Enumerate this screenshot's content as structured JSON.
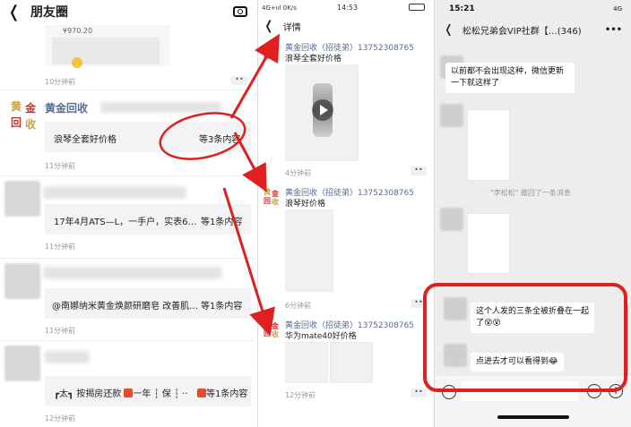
{
  "colors": {
    "link": "#576b95",
    "annotation_red": "#e02020",
    "gold": "#c9a23a"
  },
  "moments": {
    "title": "朋友圈",
    "back_icon": "chevron-left-icon",
    "camera_icon": "camera-icon",
    "top_price": "¥970.20",
    "post0_time": "10分钟前",
    "post1": {
      "author": "黄金回收",
      "avatar_chars": [
        "黄",
        "金",
        "回",
        "收"
      ],
      "share_text": "浪琴全套好价格",
      "more_text": "等3条内容",
      "time": "11分钟前"
    },
    "post2": {
      "share_text": "17年4月ATS—L，一手户，实表6…",
      "more_text": "等1条内容",
      "time": "11分钟前"
    },
    "post3": {
      "share_text": "@南娜纳米黄金焕颜研磨皂 改善肌…",
      "more_text": "等1条内容",
      "time": "11分钟前"
    },
    "post4": {
      "share_text_a": "┏太┓ 按揭房还款",
      "share_text_b": "一年 ┆ 保 ┆ ··",
      "more_text": "等1条内容",
      "time": "12分钟前"
    },
    "dots_label": "••"
  },
  "detail": {
    "status_left": "4G+ııl 0K/s",
    "status_time": "14:53",
    "title": "详情",
    "items": [
      {
        "author": "黄金回收（招徒弟）13752308765",
        "text": "浪琴全套好价格",
        "time": "4分钟前"
      },
      {
        "author": "黄金回收（招徒弟）13752308765",
        "text": "浪琴好价格",
        "time": "6分钟前"
      },
      {
        "author": "黄金回收（招徒弟）13752308765",
        "text": "华为mate40好价格",
        "time": "12分钟前"
      }
    ]
  },
  "chat": {
    "status_time": "15:21",
    "status_net": "4G",
    "title": "松松兄弟会VIP社群【…(346)",
    "more": "•••",
    "msg1": "以前都不会出现这种，微信更新一下就这样了",
    "system": "\"李松松\" 撤回了一条消息",
    "msg2": "这个人发的三条全被折叠在一起了😵😵",
    "msg3": "点进去才可以看得到😂"
  }
}
